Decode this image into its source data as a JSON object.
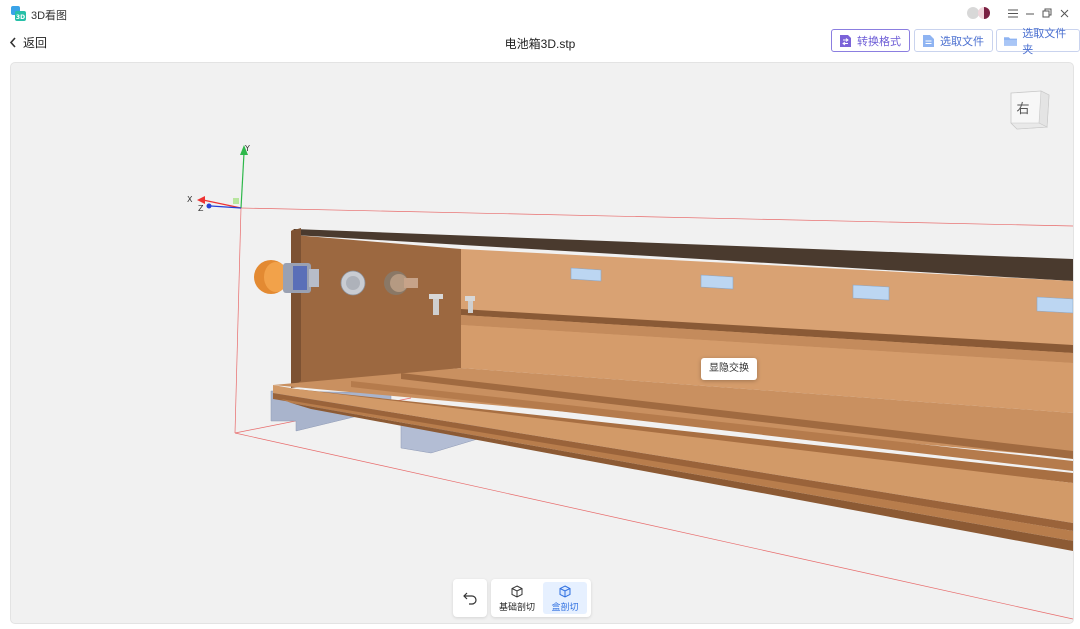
{
  "app": {
    "title": "3D看图"
  },
  "header": {
    "back_label": "返回",
    "file_name": "电池箱3D.stp",
    "buttons": {
      "convert": "转换格式",
      "select_file": "选取文件",
      "select_folder": "选取文件夹"
    }
  },
  "viewport": {
    "view_cube_label": "右",
    "axes": {
      "x": "X",
      "y": "Y",
      "z": "Z"
    },
    "tooltip": "显隐交换"
  },
  "toolbar": {
    "basic_section": "基础剖切",
    "box_section": "盒剖切"
  },
  "colors": {
    "accent": "#6b5bd6",
    "model": "#c98c5e",
    "selected_tool_bg": "#e6f0ff"
  }
}
